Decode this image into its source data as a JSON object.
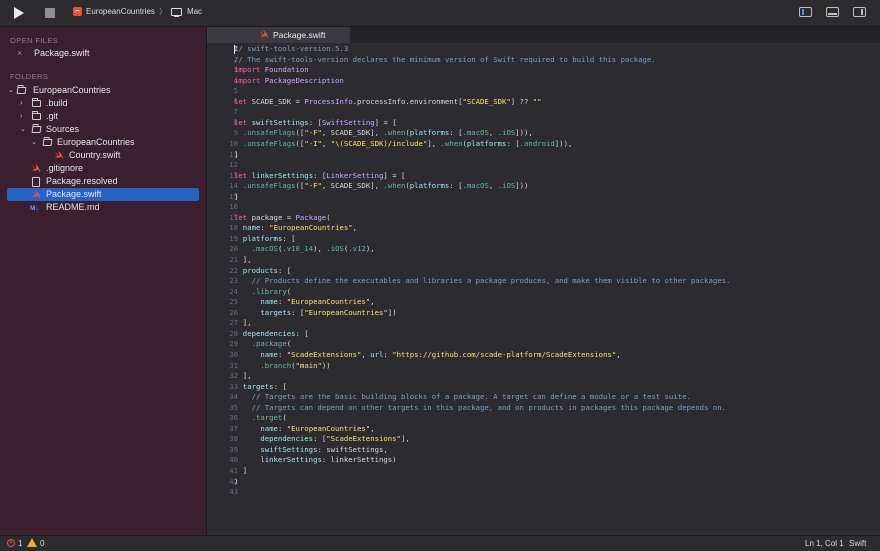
{
  "toolbar": {
    "scheme": "EuropeanCountries",
    "separator": "〉",
    "destination": "Mac"
  },
  "sidebar": {
    "open_files_title": "OPEN FILES",
    "open_files": [
      {
        "name": "Package.swift"
      }
    ],
    "folders_title": "FOLDERS",
    "tree": [
      {
        "label": "EuropeanCountries",
        "type": "folder",
        "expanded": true
      },
      {
        "label": ".build",
        "type": "folder",
        "expanded": false
      },
      {
        "label": ".git",
        "type": "folder",
        "expanded": false
      },
      {
        "label": "Sources",
        "type": "folder",
        "expanded": true
      },
      {
        "label": "EuropeanCountries",
        "type": "folder",
        "expanded": true
      },
      {
        "label": "Country.swift",
        "type": "swift"
      },
      {
        "label": ".gitignore",
        "type": "swift"
      },
      {
        "label": "Package.resolved",
        "type": "file"
      },
      {
        "label": "Package.swift",
        "type": "swift",
        "selected": true
      },
      {
        "label": "README.md",
        "type": "markdown",
        "badge": "M↓"
      }
    ]
  },
  "editor": {
    "tab": "Package.swift",
    "line_numbers": [
      "1",
      "2",
      "3",
      "4",
      "5",
      "6",
      "7",
      "8",
      "9",
      "10",
      "11",
      "12",
      "13",
      "14",
      "15",
      "16",
      "17",
      "18",
      "19",
      "20",
      "21",
      "22",
      "23",
      "24",
      "25",
      "26",
      "27",
      "28",
      "29",
      "30",
      "31",
      "32",
      "33",
      "34",
      "35",
      "36",
      "37",
      "38",
      "39",
      "40",
      "41",
      "42",
      "43"
    ],
    "lines": [
      "// swift-tools-version:5.3",
      "// The swift-tools-version declares the minimum version of Swift required to build this package.",
      "import Foundation",
      "import PackageDescription",
      "",
      "let SCADE_SDK = ProcessInfo.processInfo.environment[\"SCADE_SDK\"] ?? \"\"",
      "",
      "let swiftSettings: [SwiftSetting] = [",
      "  .unsafeFlags([\"-F\", SCADE_SDK], .when(platforms: [.macOS, .iOS])),",
      "  .unsafeFlags([\"-I\", \"\\(SCADE_SDK)/include\"], .when(platforms: [.android])),",
      "]",
      "",
      "let linkerSettings: [LinkerSetting] = [",
      "  .unsafeFlags([\"-F\", SCADE_SDK], .when(platforms: [.macOS, .iOS]))",
      "]",
      "",
      "let package = Package(",
      "  name: \"EuropeanCountries\",",
      "  platforms: [",
      "    .macOS(.v10_14), .iOS(.v12),",
      "  ],",
      "  products: [",
      "    // Products define the executables and libraries a package produces, and make them visible to other packages.",
      "    .library(",
      "      name: \"EuropeanCountries\",",
      "      targets: [\"EuropeanCountries\"])",
      "  ],",
      "  dependencies: [",
      "    .package(",
      "      name: \"ScadeExtensions\", url: \"https://github.com/scade-platform/ScadeExtensions\",",
      "      .branch(\"main\"))",
      "  ],",
      "  targets: [",
      "    // Targets are the basic building blocks of a package. A target can define a module or a test suite.",
      "    // Targets can depend on other targets in this package, and on products in packages this package depends on.",
      "    .target(",
      "      name: \"EuropeanCountries\",",
      "      dependencies: [\"ScadeExtensions\"],",
      "      swiftSettings: swiftSettings,",
      "      linkerSettings: linkerSettings)",
      "  ]",
      ")",
      ""
    ]
  },
  "status": {
    "errors": "1",
    "warnings": "0",
    "position": "Ln 1, Col 1",
    "language": "Swift"
  },
  "colors": {
    "sidebar_bg": "#3a1f2e",
    "selection": "#2563c4",
    "keyword": "#fc5fa3",
    "comment": "#7e9fc7",
    "string": "#ffe26b",
    "type": "#d0a8ff",
    "function": "#67b7a4"
  }
}
